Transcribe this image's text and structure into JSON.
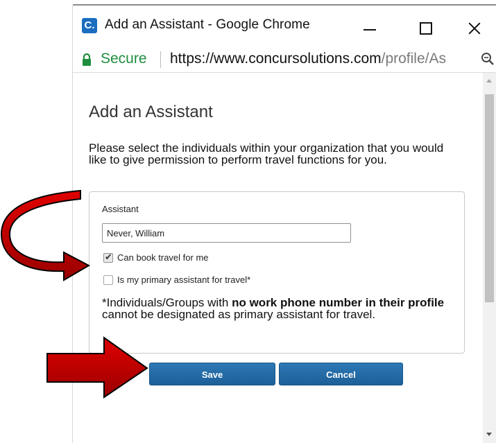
{
  "window": {
    "title": "Add an Assistant - Google Chrome",
    "app_icon_glyph": "C."
  },
  "address_bar": {
    "security_label": "Secure",
    "url_host": "https://www.concursolutions.com",
    "url_path": "/profile/As"
  },
  "dialog": {
    "heading": "Add an Assistant",
    "description": "Please select the individuals within your organization that you would like to give permission to perform travel functions for you.",
    "assistant_label": "Assistant",
    "assistant_value": "Never, William",
    "checkbox_book_travel": {
      "label": "Can book travel for me",
      "checked": true
    },
    "checkbox_primary": {
      "label": "Is my primary assistant for travel*",
      "checked": false
    },
    "note_prefix": "*Individuals/Groups with ",
    "note_bold": "no work phone number in their profile",
    "note_suffix": " cannot be designated as primary assistant for travel.",
    "save_label": "Save",
    "cancel_label": "Cancel"
  },
  "colors": {
    "button_blue": "#1f66a3",
    "secure_green": "#1e8e3e",
    "arrow_red": "#c40000"
  }
}
